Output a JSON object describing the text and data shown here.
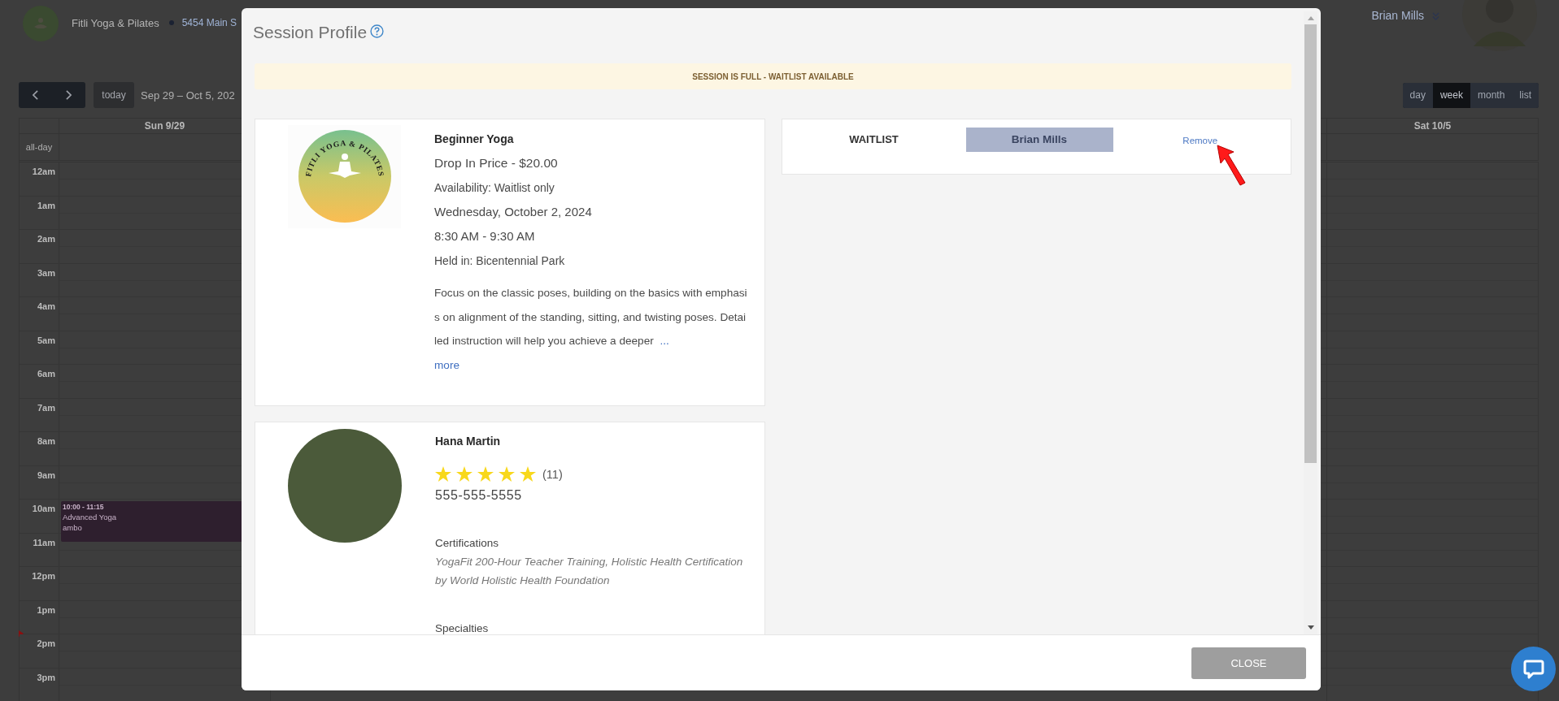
{
  "header": {
    "business": "Fitli Yoga & Pilates",
    "address": "5454 Main S",
    "user": "Brian Mills"
  },
  "toolbar": {
    "today": "today",
    "range": "Sep 29 – Oct 5, 202",
    "views": [
      {
        "label": "day",
        "selected": false
      },
      {
        "label": "week",
        "selected": true
      },
      {
        "label": "month",
        "selected": false
      },
      {
        "label": "list",
        "selected": false
      }
    ]
  },
  "calendar": {
    "all_day": "all-day",
    "days": [
      {
        "label": "Sun 9/29"
      },
      {
        "label": "Sat 10/5"
      }
    ],
    "hours": [
      {
        "label": "12am",
        "now": false
      },
      {
        "label": "1am",
        "now": false
      },
      {
        "label": "2am",
        "now": false
      },
      {
        "label": "3am",
        "now": false
      },
      {
        "label": "4am",
        "now": false
      },
      {
        "label": "5am",
        "now": false
      },
      {
        "label": "6am",
        "now": false
      },
      {
        "label": "7am",
        "now": false
      },
      {
        "label": "8am",
        "now": false
      },
      {
        "label": "9am",
        "now": false
      },
      {
        "label": "10am",
        "now": false,
        "events": [
          {
            "time": "10:00 - 11:15",
            "title": "Advanced Yoga",
            "location": "ambo"
          }
        ]
      },
      {
        "label": "11am",
        "now": false
      },
      {
        "label": "12pm",
        "now": false
      },
      {
        "label": "1pm",
        "now": true
      },
      {
        "label": "2pm",
        "now": false
      },
      {
        "label": "3pm",
        "now": false
      }
    ]
  },
  "modal": {
    "title": "Session Profile",
    "banner": "SESSION IS FULL - WAITLIST AVAILABLE",
    "session": {
      "logo_text": "FITLI YOGA & PILATES",
      "title": "Beginner Yoga",
      "details": [
        "Drop In Price - $20.00",
        "Availability: Waitlist only",
        "Wednesday, October 2, 2024",
        "8:30 AM - 9:30 AM",
        "Held in: Bicentennial Park"
      ],
      "description": "Focus on the classic poses, building on the basics with emphasis on alignment of the standing, sitting, and twisting poses. Detailed instruction will help you achieve a deeper ",
      "ellipsis": "...",
      "more": "more"
    },
    "instructor": {
      "name": "Hana Martin",
      "stars": 5,
      "review_count": "(11)",
      "phone": "555-555-5555",
      "sections": [
        {
          "heading": "Certifications",
          "text": "YogaFit 200-Hour Teacher Training, Holistic Health Certification by World Holistic Health Foundation"
        },
        {
          "heading": "Specialties"
        }
      ]
    },
    "waitlist": {
      "label": "WAITLIST",
      "entries": [
        {
          "name": "Brian Mills",
          "action": "Remove"
        }
      ]
    },
    "close": "CLOSE"
  }
}
